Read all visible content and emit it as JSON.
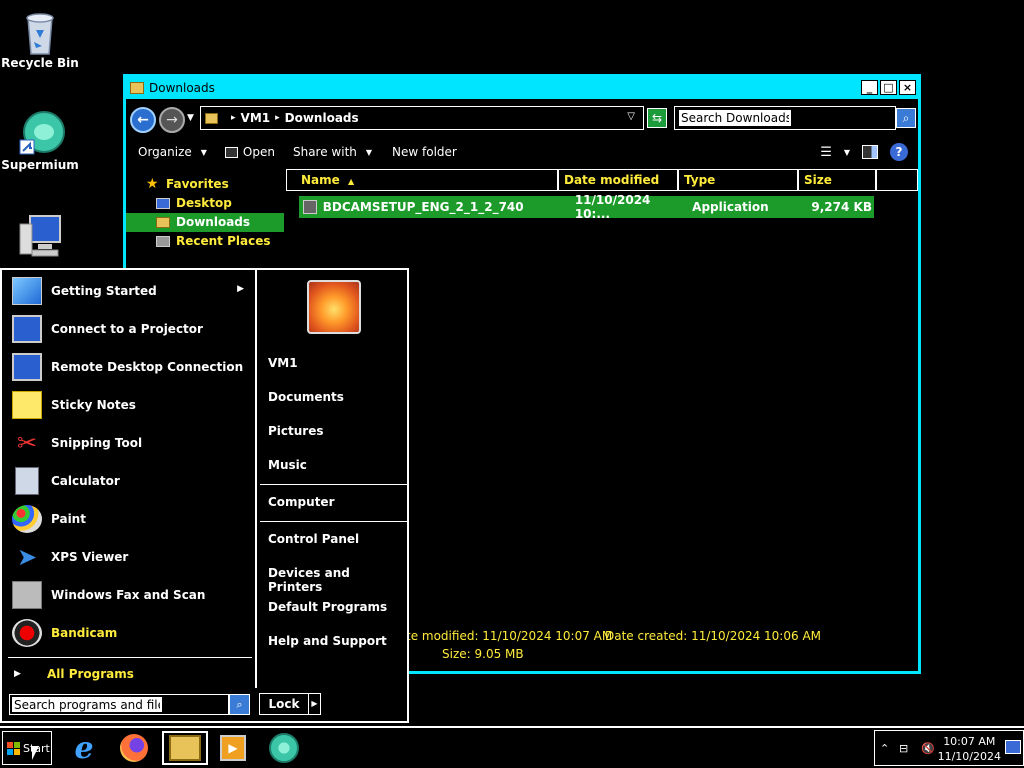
{
  "desktop": {
    "icons": [
      {
        "label": "Recycle Bin"
      },
      {
        "label": "Supermium"
      }
    ]
  },
  "explorer": {
    "title": "Downloads",
    "breadcrumb": [
      "VM1",
      "Downloads"
    ],
    "search_placeholder": "Search Downloads",
    "toolbar": {
      "organize": "Organize",
      "open": "Open",
      "share_with": "Share with",
      "new_folder": "New folder"
    },
    "nav": {
      "favorites": "Favorites",
      "desktop": "Desktop",
      "downloads": "Downloads",
      "recent_places": "Recent Places"
    },
    "columns": {
      "name": "Name",
      "date_modified": "Date modified",
      "type": "Type",
      "size": "Size"
    },
    "files": [
      {
        "name": "BDCAMSETUP_ENG_2_1_2_740",
        "date": "11/10/2024 10:...",
        "type": "Application",
        "size": "9,274 KB"
      }
    ],
    "details": {
      "date_modified": "te modified: 11/10/2024 10:07 AM",
      "date_created": "Date created: 11/10/2024 10:06 AM",
      "size": "Size: 9.05 MB"
    }
  },
  "start_menu": {
    "programs": [
      {
        "label": "Getting Started"
      },
      {
        "label": "Connect to a Projector"
      },
      {
        "label": "Remote Desktop Connection"
      },
      {
        "label": "Sticky Notes"
      },
      {
        "label": "Snipping Tool"
      },
      {
        "label": "Calculator"
      },
      {
        "label": "Paint"
      },
      {
        "label": "XPS Viewer"
      },
      {
        "label": "Windows Fax and Scan"
      },
      {
        "label": "Bandicam"
      }
    ],
    "all_programs": "All Programs",
    "search_placeholder": "Search programs and files",
    "right": {
      "user": "VM1",
      "documents": "Documents",
      "pictures": "Pictures",
      "music": "Music",
      "computer": "Computer",
      "control_panel": "Control Panel",
      "devices_printers": "Devices and Printers",
      "default_programs": "Default Programs",
      "help_support": "Help and Support"
    },
    "lock": "Lock"
  },
  "taskbar": {
    "start": "Start",
    "time": "10:07 AM",
    "date": "11/10/2024"
  }
}
